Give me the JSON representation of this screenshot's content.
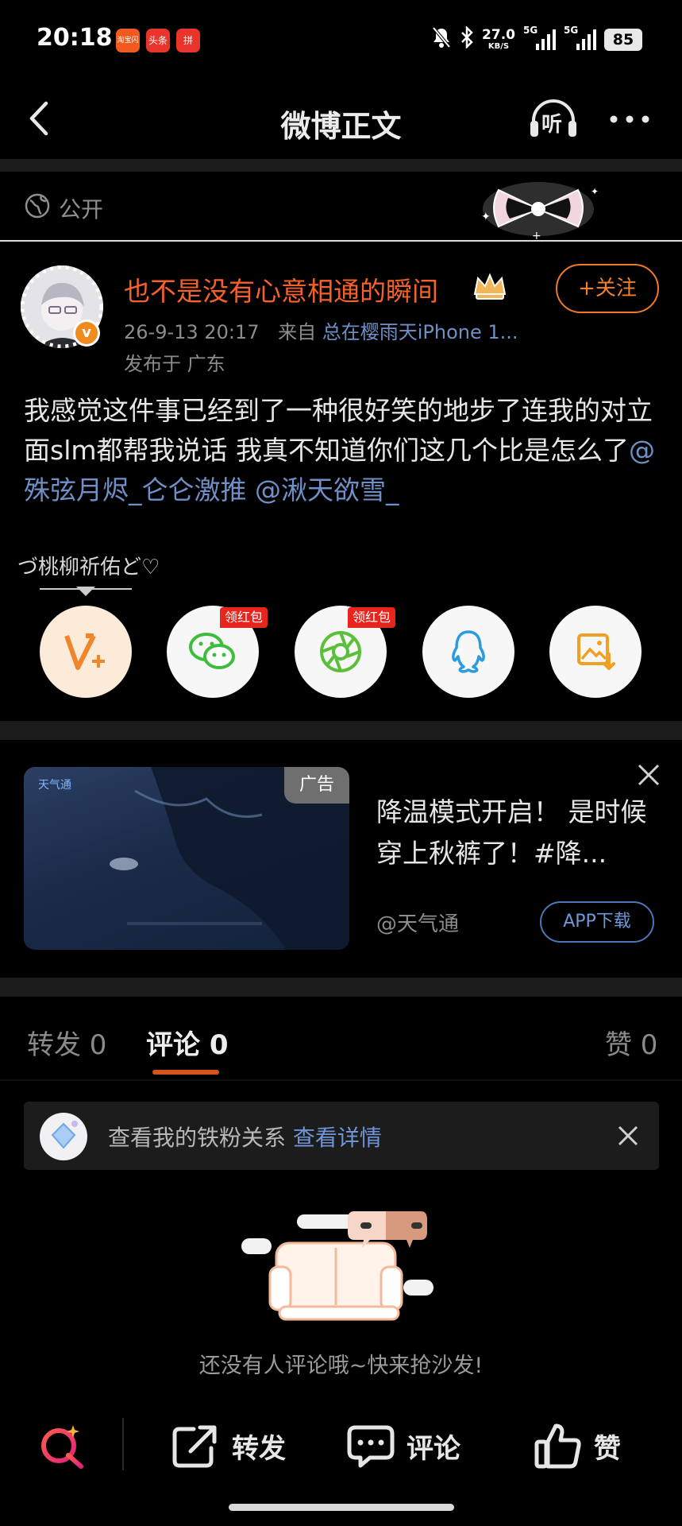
{
  "status_bar": {
    "time": "20:18",
    "apps": [
      {
        "label": "淘宝闪购",
        "color": "#f05a1f"
      },
      {
        "label": "头条",
        "color": "#e8342b"
      },
      {
        "label": "拼",
        "color": "#e8342b"
      }
    ],
    "net_speed": "27.0",
    "net_unit": "KB/S",
    "sim1": "5G",
    "sim2": "5G",
    "battery": "85"
  },
  "header": {
    "title": "微博正文",
    "listen_label": "听"
  },
  "visibility": {
    "label": "公开"
  },
  "post": {
    "username": "也不是没有心意相通的瞬间",
    "follow_label": "+关注",
    "timestamp": "26-9-13 20:17",
    "from_label": "来自",
    "source": "总在樱雨天iPhone 1...",
    "location": "发布于 广东",
    "text_main": "我感觉这件事已经到了一种很好笑的地步了连我的对立面slm都帮我说话 我真不知道你们这几个比是怎么了",
    "mention1": "@殊弦月烬_仑仑激推",
    "mention2": "@湫天欲雪_"
  },
  "signature": {
    "text": "づ桃柳祈佑ど♡"
  },
  "share": {
    "red_packet_label": "领红包",
    "items": [
      {
        "name": "weibo-v-plus"
      },
      {
        "name": "wechat"
      },
      {
        "name": "moments"
      },
      {
        "name": "qq"
      },
      {
        "name": "save-image"
      }
    ]
  },
  "ad": {
    "badge": "广告",
    "brand_logo": "天气通",
    "title": "降温模式开启！ 是时候穿上秋裤了！#降...",
    "source": "@天气通",
    "download_label": "APP下载"
  },
  "tabs": {
    "repost": "转发 0",
    "comment": "评论 0",
    "like": "赞 0"
  },
  "fan_banner": {
    "text": "查看我的铁粉关系",
    "link": "查看详情"
  },
  "empty": {
    "text": "还没有人评论哦~快来抢沙发!"
  },
  "bottom_bar": {
    "repost": "转发",
    "comment": "评论",
    "like": "赞"
  },
  "colors": {
    "accent_orange": "#f5612a",
    "link_blue": "#6f8fc7",
    "background": "#000000"
  }
}
